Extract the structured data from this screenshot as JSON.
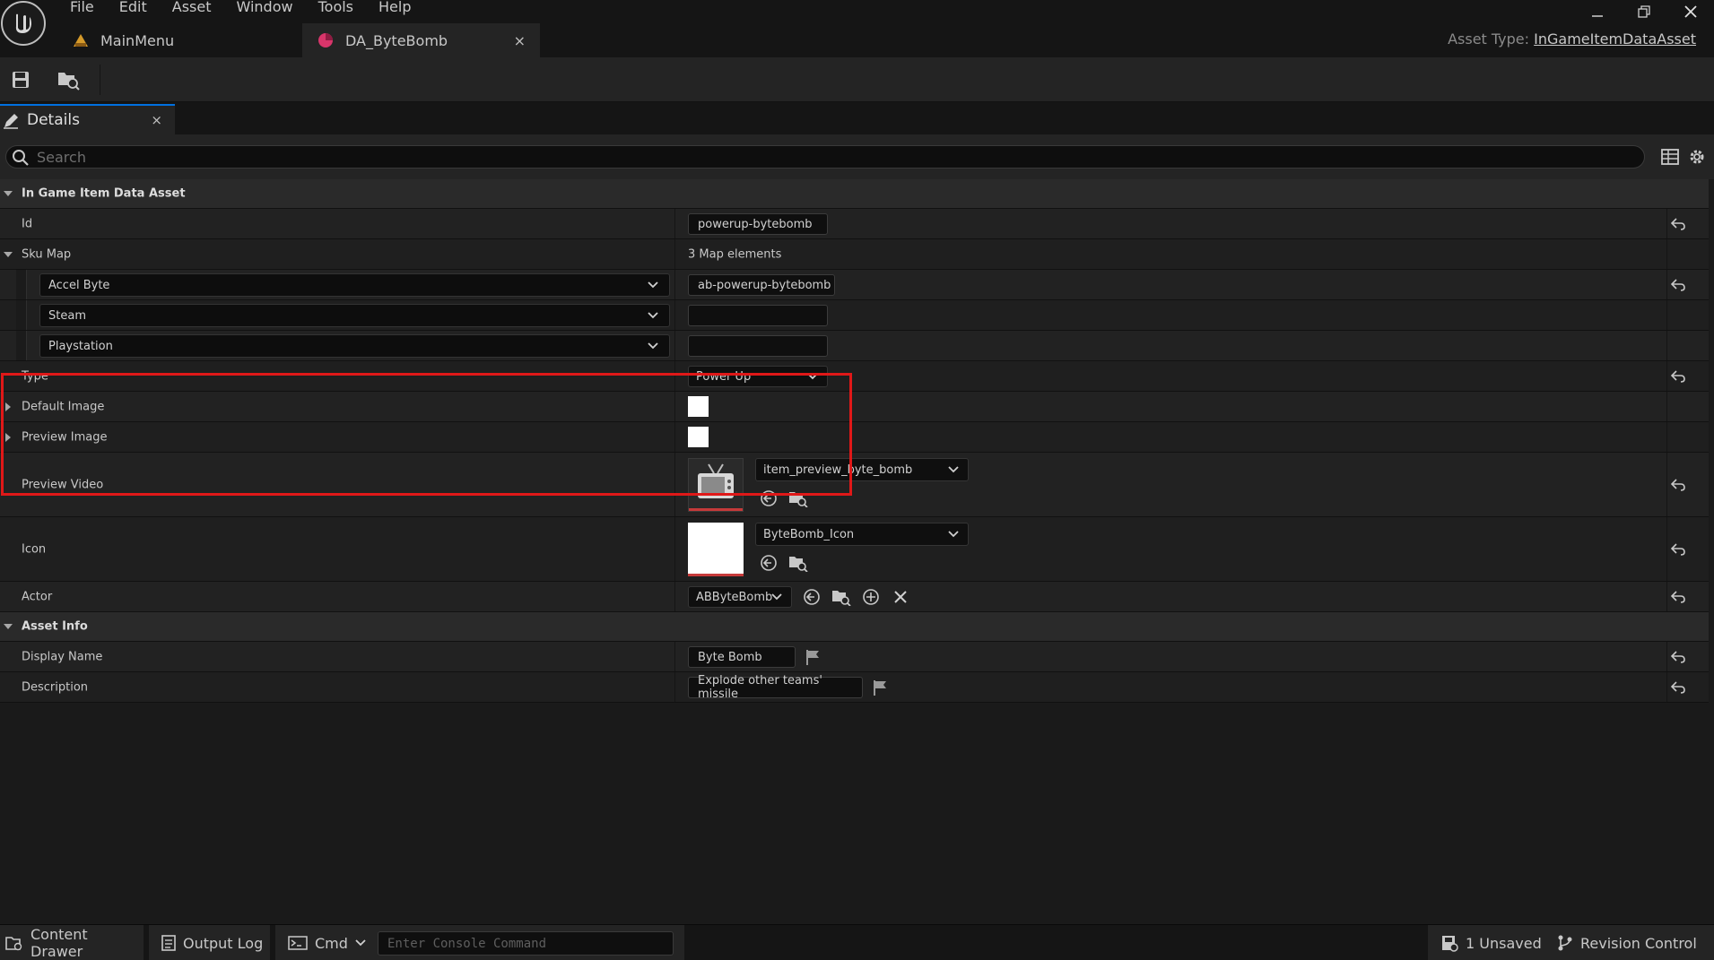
{
  "menu": [
    "File",
    "Edit",
    "Asset",
    "Window",
    "Tools",
    "Help"
  ],
  "tabs": [
    {
      "label": "MainMenu",
      "icon": "widget-blueprint-icon"
    },
    {
      "label": "DA_ByteBomb",
      "icon": "data-asset-icon",
      "close": "×"
    }
  ],
  "asset_type": {
    "prefix": "Asset Type:",
    "value": "InGameItemDataAsset"
  },
  "details_tab": {
    "label": "Details",
    "close": "×"
  },
  "search": {
    "placeholder": "Search"
  },
  "categories": {
    "in_game_item": "In Game Item Data Asset",
    "asset_info": "Asset Info"
  },
  "props": {
    "id": {
      "label": "Id",
      "value": "powerup-bytebomb"
    },
    "sku_map": {
      "label": "Sku Map",
      "summary": "3 Map elements",
      "entries": [
        {
          "key": "Accel Byte",
          "value": "ab-powerup-bytebomb"
        },
        {
          "key": "Steam",
          "value": ""
        },
        {
          "key": "Playstation",
          "value": ""
        }
      ]
    },
    "type": {
      "label": "Type",
      "value": "Power Up"
    },
    "default_image": {
      "label": "Default Image"
    },
    "preview_image": {
      "label": "Preview Image"
    },
    "preview_video": {
      "label": "Preview Video",
      "asset": "item_preview_byte_bomb"
    },
    "icon": {
      "label": "Icon",
      "asset": "ByteBomb_Icon"
    },
    "actor": {
      "label": "Actor",
      "value": "ABByteBomb"
    },
    "display_name": {
      "label": "Display Name",
      "value": "Byte Bomb"
    },
    "description": {
      "label": "Description",
      "value": "Explode other teams' missile"
    }
  },
  "status": {
    "content_drawer": "Content Drawer",
    "output_log": "Output Log",
    "cmd": "Cmd",
    "console_placeholder": "Enter Console Command",
    "unsaved": "1 Unsaved",
    "revision": "Revision Control"
  },
  "colors": {
    "highlight": "#e01818",
    "accent": "#0070e0"
  }
}
